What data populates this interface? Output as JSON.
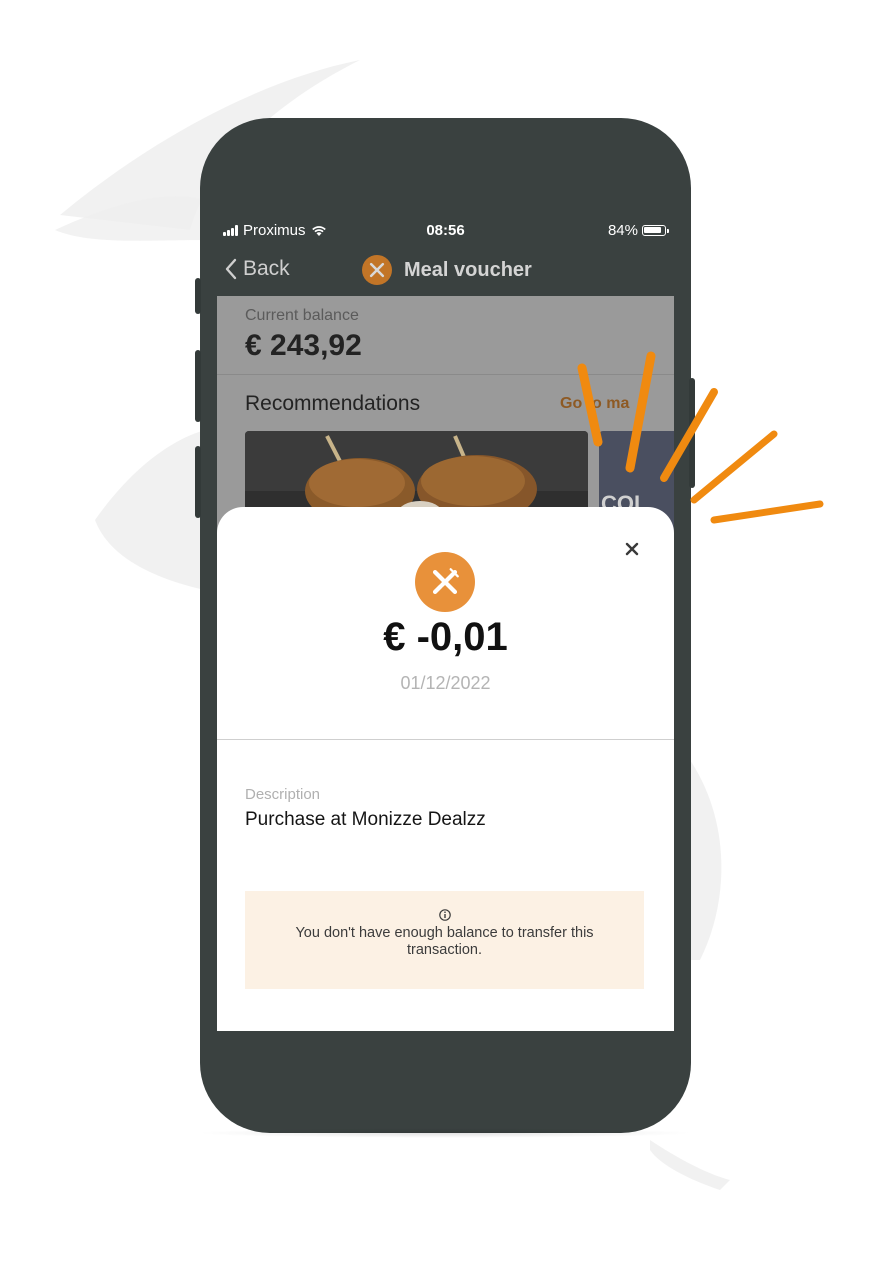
{
  "status_bar": {
    "carrier": "Proximus",
    "time": "08:56",
    "battery": "84%"
  },
  "nav": {
    "back_label": "Back",
    "title": "Meal voucher",
    "title_icon": "fork-knife-icon"
  },
  "balance": {
    "label": "Current balance",
    "value": "€ 243,92"
  },
  "recommendations": {
    "title": "Recommendations",
    "link": "Go to ma",
    "second_card_text": "COL"
  },
  "transaction": {
    "icon": "fork-knife-icon",
    "amount": "€ -0,01",
    "date": "01/12/2022",
    "description_label": "Description",
    "description": "Purchase at Monizze Dealzz",
    "notice": "You don't have enough balance to transfer this transaction."
  },
  "colors": {
    "accent": "#e8913a",
    "accent_dim": "#c27527",
    "phone_body": "#3a4140",
    "notice_bg": "#fcf1e4"
  }
}
